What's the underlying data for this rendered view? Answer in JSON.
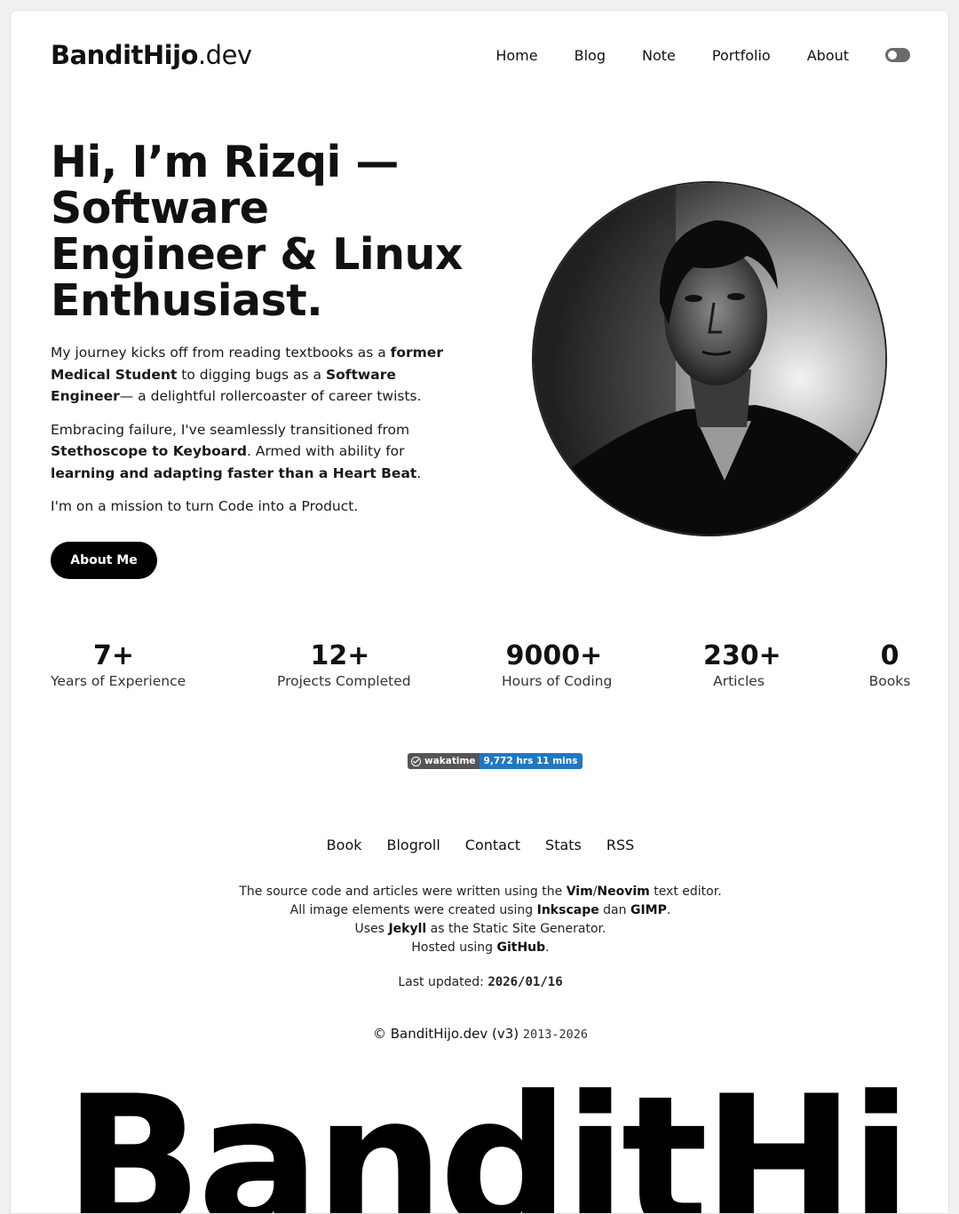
{
  "header": {
    "logo_brand": "BanditHijo",
    "logo_tld": ".dev",
    "nav": [
      "Home",
      "Blog",
      "Note",
      "Portfolio",
      "About"
    ],
    "theme_toggle_icon": "toggle-switch-icon"
  },
  "hero": {
    "title": "Hi, I’m Rizqi — Software Engineer & Linux Enthusiast.",
    "p1": {
      "t1": "My journey kicks off from reading textbooks as a ",
      "b1": "former Medical Student",
      "t2": " to digging bugs as a ",
      "b2": "Software Engineer",
      "t3": "— a delightful rollercoaster of career twists."
    },
    "p2": {
      "t1": "Embracing failure, I've seamlessly transitioned from ",
      "b1": "Stethoscope to Keyboard",
      "t2": ". Armed with ability for ",
      "b2": "learning and adapting faster than a Heart Beat",
      "t3": "."
    },
    "p3": "I'm on a mission to turn Code into a Product.",
    "button": "About Me"
  },
  "stats": [
    {
      "value": "7+",
      "label": "Years of Experience"
    },
    {
      "value": "12+",
      "label": "Projects Completed"
    },
    {
      "value": "9000+",
      "label": "Hours of Coding"
    },
    {
      "value": "230+",
      "label": "Articles"
    },
    {
      "value": "0",
      "label": "Books"
    }
  ],
  "badge": {
    "left": "wakatime",
    "right": "9,772 hrs 11 mins",
    "left_color": "#555555",
    "right_color": "#1f78c1"
  },
  "footer": {
    "links": [
      "Book",
      "Blogroll",
      "Contact",
      "Stats",
      "RSS"
    ],
    "line1": {
      "t1": "The source code and articles were written using the ",
      "b1": "Vim",
      "sep": "/",
      "b2": "Neovim",
      "t2": " text editor."
    },
    "line2": {
      "t1": "All image elements were created using ",
      "b1": "Inkscape",
      "t2": " dan ",
      "b2": "GIMP",
      "t3": "."
    },
    "line3": {
      "t1": "Uses ",
      "b1": "Jekyll",
      "t2": " as the Static Site Generator."
    },
    "line4": {
      "t1": "Hosted using ",
      "b1": "GitHub",
      "t2": "."
    },
    "updated_label": "Last updated: ",
    "updated_date": "2026/01/16",
    "copyright_text": "© BanditHijo.dev (v3) ",
    "copyright_years": "2013-2026",
    "giant_wordmark": "BanditHijo"
  }
}
